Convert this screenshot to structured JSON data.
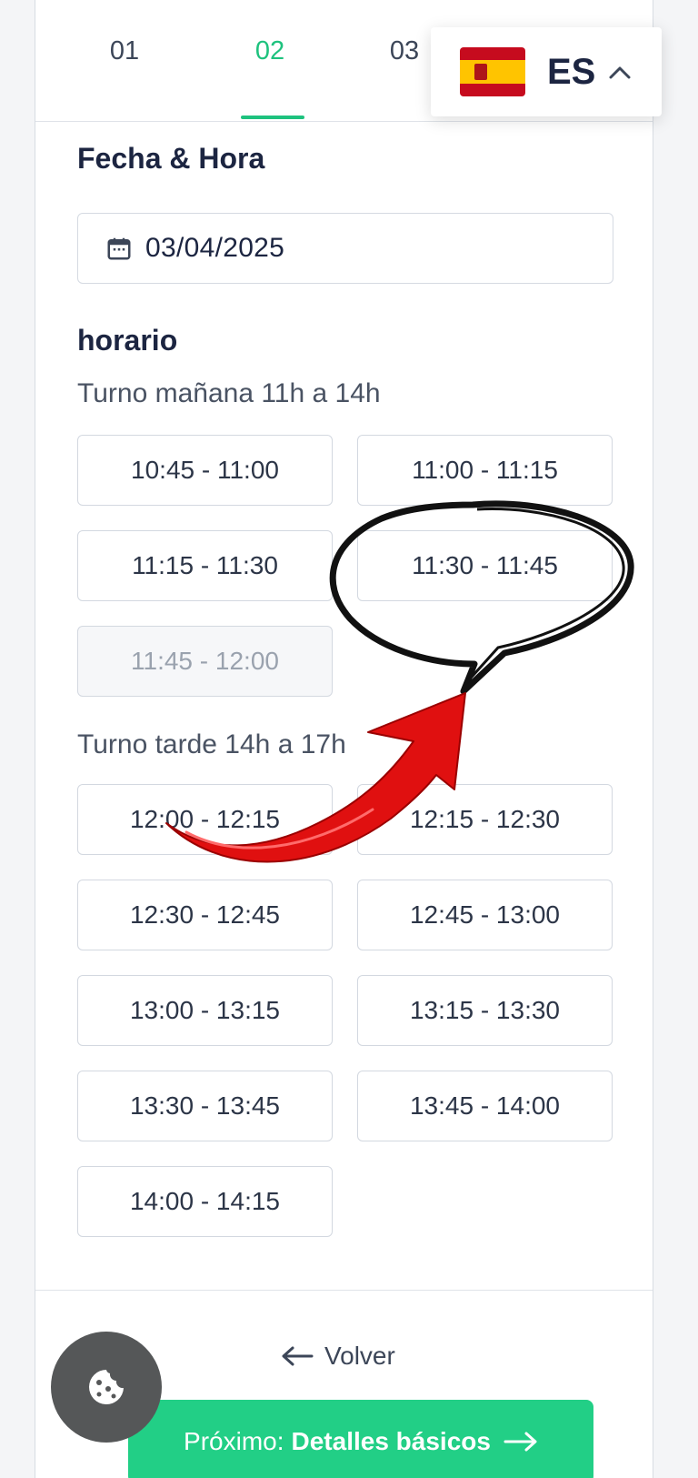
{
  "steps": [
    {
      "label": "01",
      "active": false
    },
    {
      "label": "02",
      "active": true
    },
    {
      "label": "03",
      "active": false
    }
  ],
  "language": {
    "code": "ES",
    "flag": "spain-flag-icon"
  },
  "section_title": "Fecha & Hora",
  "date": {
    "value": "03/04/2025",
    "icon": "calendar-icon"
  },
  "schedule_title": "horario",
  "morning": {
    "label": "Turno mañana 11h a 14h",
    "slots": [
      {
        "label": "10:45 - 11:00",
        "disabled": false
      },
      {
        "label": "11:00 - 11:15",
        "disabled": false
      },
      {
        "label": "11:15 - 11:30",
        "disabled": false
      },
      {
        "label": "11:30 - 11:45",
        "disabled": false
      },
      {
        "label": "11:45 - 12:00",
        "disabled": true
      }
    ]
  },
  "afternoon": {
    "label": "Turno tarde 14h a 17h",
    "slots": [
      {
        "label": "12:00 - 12:15",
        "disabled": false
      },
      {
        "label": "12:15 - 12:30",
        "disabled": false
      },
      {
        "label": "12:30 - 12:45",
        "disabled": false
      },
      {
        "label": "12:45 - 13:00",
        "disabled": false
      },
      {
        "label": "13:00 - 13:15",
        "disabled": false
      },
      {
        "label": "13:15 - 13:30",
        "disabled": false
      },
      {
        "label": "13:30 - 13:45",
        "disabled": false
      },
      {
        "label": "13:45 - 14:00",
        "disabled": false
      },
      {
        "label": "14:00 - 14:15",
        "disabled": false
      }
    ]
  },
  "footer": {
    "back_label": "Volver",
    "next_prefix": "Próximo:",
    "next_label": "Detalles básicos"
  },
  "colors": {
    "accent": "#22cf86",
    "annotation_arrow": "#e01010"
  }
}
